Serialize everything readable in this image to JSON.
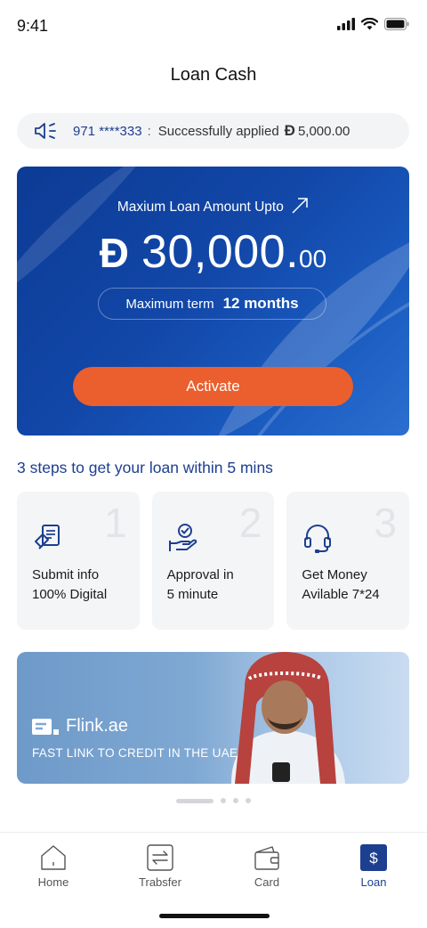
{
  "status_bar": {
    "time": "9:41"
  },
  "header": {
    "title": "Loan Cash"
  },
  "notice": {
    "phone": "971 ****333",
    "separator": ":",
    "message": "Successfully applied",
    "currency_symbol": "Đ",
    "amount": "5,000.00",
    "icon": "speaker-icon"
  },
  "loan_card": {
    "label": "Maxium Loan Amount Upto",
    "currency_symbol": "Đ",
    "amount_int": "30,000.",
    "amount_dec": "00",
    "term_label": "Maximum term",
    "term_value": "12 months",
    "activate_label": "Activate"
  },
  "steps": {
    "title": "3 steps to get your loan within 5 mins",
    "items": [
      {
        "number": "1",
        "line1": "Submit info",
        "line2": "100% Digital",
        "icon": "document-icon"
      },
      {
        "number": "2",
        "line1": "Approval in",
        "line2": "5 minute",
        "icon": "approval-hand-icon"
      },
      {
        "number": "3",
        "line1": "Get Money",
        "line2": "Avilable 7*24",
        "icon": "headset-icon"
      }
    ]
  },
  "banner": {
    "brand": "Flink.ae",
    "tagline": "FAST LINK TO CREDIT IN THE UAE"
  },
  "tab_bar": {
    "items": [
      {
        "label": "Home",
        "icon": "home-icon",
        "active": false
      },
      {
        "label": "Trabsfer",
        "icon": "transfer-icon",
        "active": false
      },
      {
        "label": "Card",
        "icon": "wallet-icon",
        "active": false
      },
      {
        "label": "Loan",
        "icon": "loan-dollar-icon",
        "active": true
      }
    ]
  },
  "colors": {
    "brand_blue": "#1d3f8f",
    "card_blue": "#1247a8",
    "accent_orange": "#ea5f2d"
  }
}
